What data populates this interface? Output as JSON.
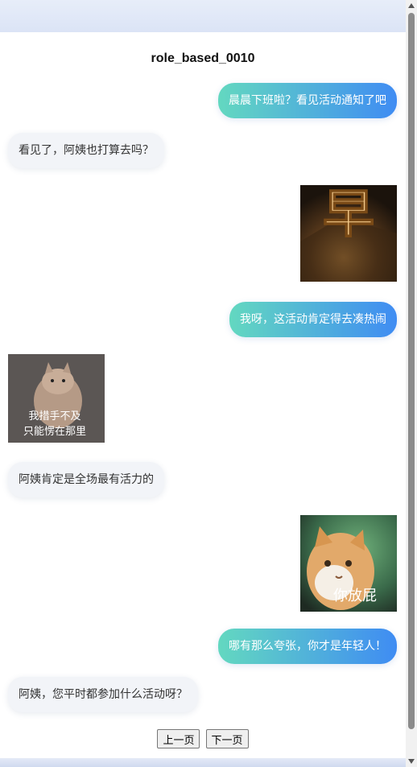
{
  "title": "role_based_0010",
  "messages": [
    {
      "side": "right",
      "kind": "text",
      "text": "晨晨下班啦？看见活动通知了吧"
    },
    {
      "side": "left",
      "kind": "text",
      "text": "看见了，阿姨也打算去吗？"
    },
    {
      "side": "right",
      "kind": "sticker",
      "sticker_text": "早"
    },
    {
      "side": "right",
      "kind": "text",
      "text": "我呀，这活动肯定得去凑热闹"
    },
    {
      "side": "left",
      "kind": "sticker",
      "sticker_text_line1": "我措手不及",
      "sticker_text_line2": "只能愣在那里"
    },
    {
      "side": "left",
      "kind": "text",
      "text": "阿姨肯定是全场最有活力的"
    },
    {
      "side": "right",
      "kind": "sticker",
      "sticker_text": "你放屁"
    },
    {
      "side": "right",
      "kind": "text",
      "text": "哪有那么夸张，你才是年轻人！"
    },
    {
      "side": "left",
      "kind": "text",
      "text": "阿姨，您平时都参加什么活动呀？"
    }
  ],
  "pager": {
    "prev_label": "上一页",
    "next_label": "下一页"
  }
}
